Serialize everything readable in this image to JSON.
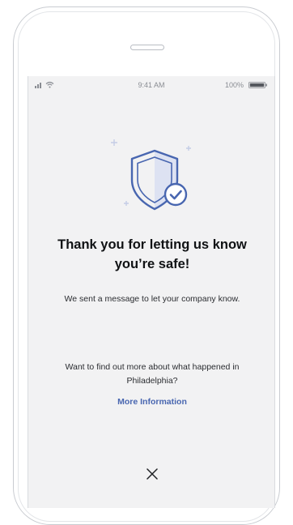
{
  "status_bar": {
    "time": "9:41 AM",
    "battery": "100%",
    "signal_icon": "cellular-signal-icon",
    "wifi_icon": "wifi-icon",
    "battery_icon": "battery-icon"
  },
  "illustration": {
    "icon": "shield-check-icon",
    "accent_color": "#4866b0"
  },
  "message": {
    "title": "Thank you for letting us know you’re safe!",
    "body": "We sent a message to let your company know."
  },
  "follow_up": {
    "question": "Want to find out more about what happened in Philadelphia?",
    "link_label": "More Information"
  },
  "close": {
    "icon": "close-icon"
  }
}
